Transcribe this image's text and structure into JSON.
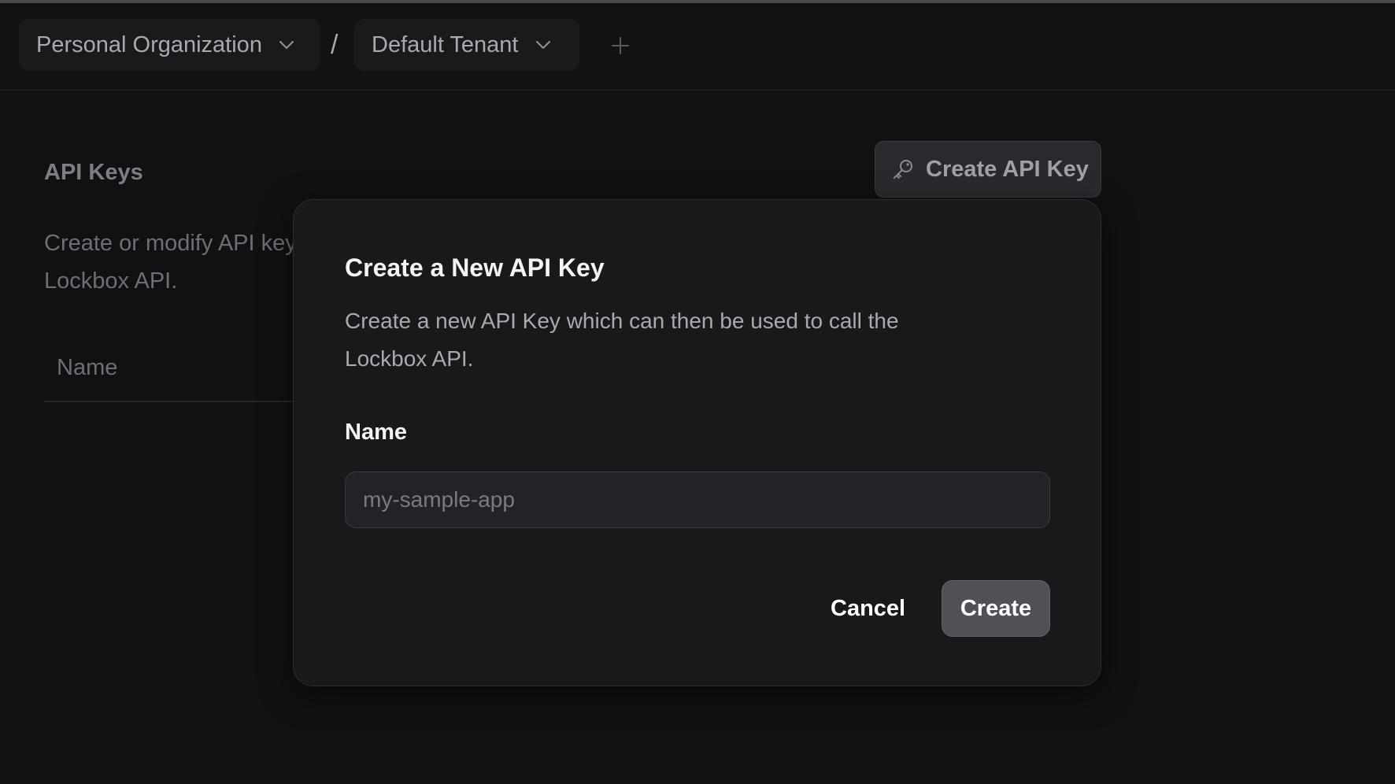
{
  "header": {
    "organization": "Personal Organization",
    "separator": "/",
    "tenant": "Default Tenant",
    "add_icon": "plus-icon",
    "dropdown_icon": "chevron-down-icon"
  },
  "background": {
    "section_title": "API Keys",
    "section_description": "Create or modify API keys which can be used to call the Lockbox API.",
    "section_description_line1": "Create or modify API key",
    "section_description_line2": "Lockbox API.",
    "table_header_name": "Name",
    "create_button_label": "Create API Key",
    "create_button_icon": "key-icon"
  },
  "modal": {
    "title": "Create a New API Key",
    "description": "Create a new API Key which can then be used to call the Lockbox API.",
    "name_label": "Name",
    "name_value": "",
    "name_placeholder": "my-sample-app",
    "cancel_label": "Cancel",
    "create_label": "Create"
  },
  "colors": {
    "background": "#111113",
    "modal_background": "#19191c",
    "primary_button": "#505057"
  }
}
